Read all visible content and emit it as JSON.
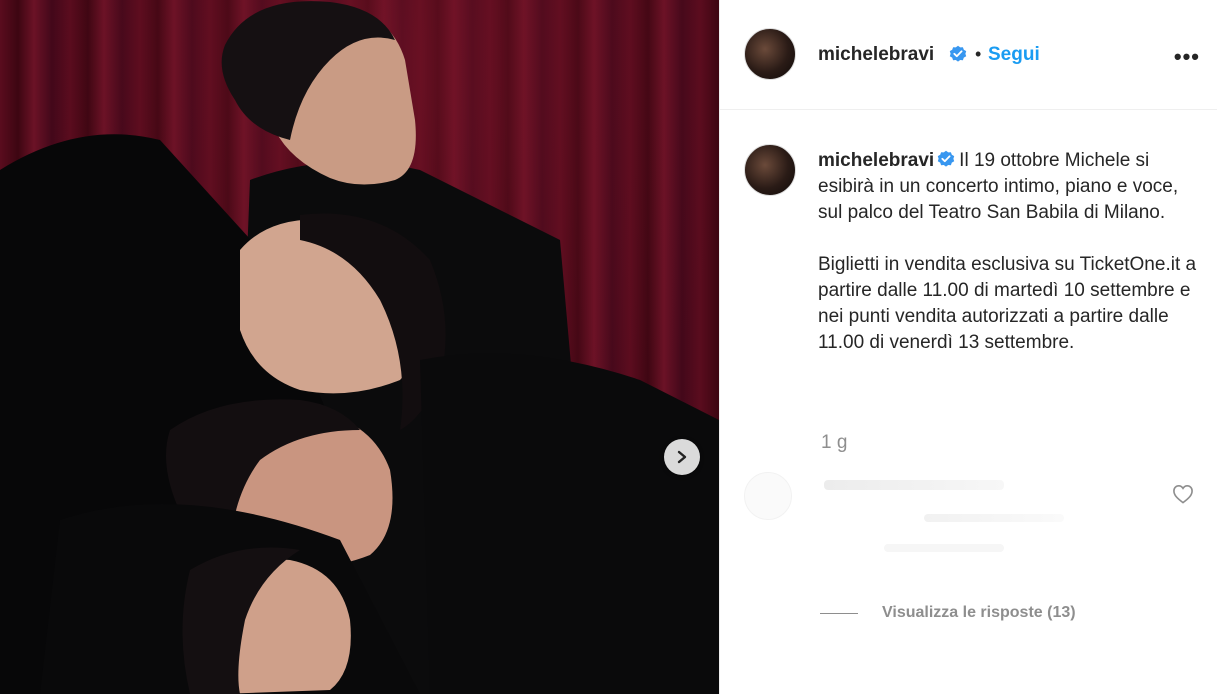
{
  "post": {
    "username": "michelebravi",
    "follow_label": "Segui",
    "separator": "•",
    "more_label": "•••"
  },
  "caption": {
    "username": "michelebravi",
    "paragraph1": "Il 19 ottobre Michele si esibirà in un concerto intimo, piano e voce, sul palco del Teatro San Babila di Milano.",
    "paragraph2": "Biglietti in vendita esclusiva su TicketOne.it a partire dalle 11.00 di martedì 10 settembre e nei punti vendita autorizzati a partire dalle 11.00 di venerdì 13 settembre."
  },
  "timestamp": "1 g",
  "comments": {
    "replies_label": "Visualizza le risposte (13)"
  },
  "colors": {
    "accent": "#1a9cf2",
    "verified": "#3897f0",
    "muted": "#8e8e8e",
    "curtain": "#5a0c1e"
  },
  "icons": {
    "verified": "verified-badge-icon",
    "next": "chevron-right-icon",
    "heart": "heart-outline-icon",
    "more": "more-horizontal-icon"
  }
}
